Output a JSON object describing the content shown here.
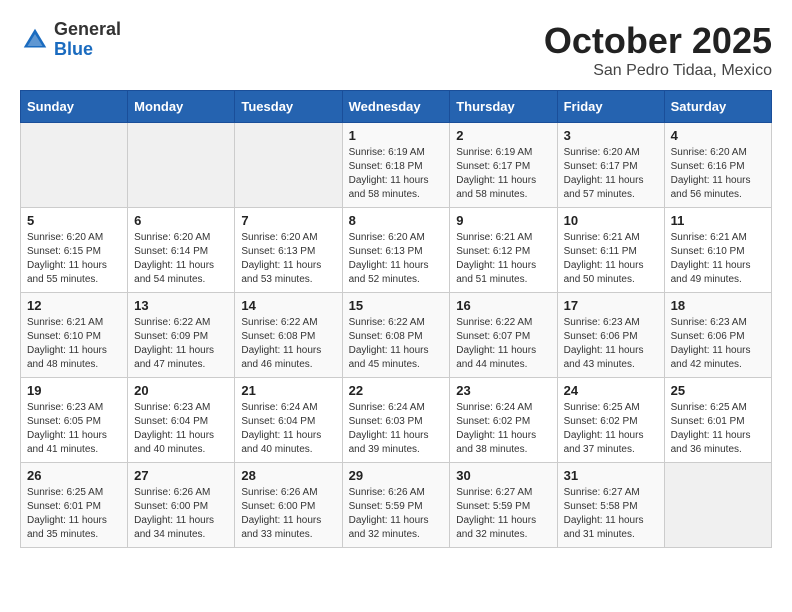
{
  "header": {
    "logo_general": "General",
    "logo_blue": "Blue",
    "month_title": "October 2025",
    "location": "San Pedro Tidaa, Mexico"
  },
  "days_of_week": [
    "Sunday",
    "Monday",
    "Tuesday",
    "Wednesday",
    "Thursday",
    "Friday",
    "Saturday"
  ],
  "weeks": [
    [
      {
        "day": "",
        "sunrise": "",
        "sunset": "",
        "daylight": ""
      },
      {
        "day": "",
        "sunrise": "",
        "sunset": "",
        "daylight": ""
      },
      {
        "day": "",
        "sunrise": "",
        "sunset": "",
        "daylight": ""
      },
      {
        "day": "1",
        "sunrise": "Sunrise: 6:19 AM",
        "sunset": "Sunset: 6:18 PM",
        "daylight": "Daylight: 11 hours and 58 minutes."
      },
      {
        "day": "2",
        "sunrise": "Sunrise: 6:19 AM",
        "sunset": "Sunset: 6:17 PM",
        "daylight": "Daylight: 11 hours and 58 minutes."
      },
      {
        "day": "3",
        "sunrise": "Sunrise: 6:20 AM",
        "sunset": "Sunset: 6:17 PM",
        "daylight": "Daylight: 11 hours and 57 minutes."
      },
      {
        "day": "4",
        "sunrise": "Sunrise: 6:20 AM",
        "sunset": "Sunset: 6:16 PM",
        "daylight": "Daylight: 11 hours and 56 minutes."
      }
    ],
    [
      {
        "day": "5",
        "sunrise": "Sunrise: 6:20 AM",
        "sunset": "Sunset: 6:15 PM",
        "daylight": "Daylight: 11 hours and 55 minutes."
      },
      {
        "day": "6",
        "sunrise": "Sunrise: 6:20 AM",
        "sunset": "Sunset: 6:14 PM",
        "daylight": "Daylight: 11 hours and 54 minutes."
      },
      {
        "day": "7",
        "sunrise": "Sunrise: 6:20 AM",
        "sunset": "Sunset: 6:13 PM",
        "daylight": "Daylight: 11 hours and 53 minutes."
      },
      {
        "day": "8",
        "sunrise": "Sunrise: 6:20 AM",
        "sunset": "Sunset: 6:13 PM",
        "daylight": "Daylight: 11 hours and 52 minutes."
      },
      {
        "day": "9",
        "sunrise": "Sunrise: 6:21 AM",
        "sunset": "Sunset: 6:12 PM",
        "daylight": "Daylight: 11 hours and 51 minutes."
      },
      {
        "day": "10",
        "sunrise": "Sunrise: 6:21 AM",
        "sunset": "Sunset: 6:11 PM",
        "daylight": "Daylight: 11 hours and 50 minutes."
      },
      {
        "day": "11",
        "sunrise": "Sunrise: 6:21 AM",
        "sunset": "Sunset: 6:10 PM",
        "daylight": "Daylight: 11 hours and 49 minutes."
      }
    ],
    [
      {
        "day": "12",
        "sunrise": "Sunrise: 6:21 AM",
        "sunset": "Sunset: 6:10 PM",
        "daylight": "Daylight: 11 hours and 48 minutes."
      },
      {
        "day": "13",
        "sunrise": "Sunrise: 6:22 AM",
        "sunset": "Sunset: 6:09 PM",
        "daylight": "Daylight: 11 hours and 47 minutes."
      },
      {
        "day": "14",
        "sunrise": "Sunrise: 6:22 AM",
        "sunset": "Sunset: 6:08 PM",
        "daylight": "Daylight: 11 hours and 46 minutes."
      },
      {
        "day": "15",
        "sunrise": "Sunrise: 6:22 AM",
        "sunset": "Sunset: 6:08 PM",
        "daylight": "Daylight: 11 hours and 45 minutes."
      },
      {
        "day": "16",
        "sunrise": "Sunrise: 6:22 AM",
        "sunset": "Sunset: 6:07 PM",
        "daylight": "Daylight: 11 hours and 44 minutes."
      },
      {
        "day": "17",
        "sunrise": "Sunrise: 6:23 AM",
        "sunset": "Sunset: 6:06 PM",
        "daylight": "Daylight: 11 hours and 43 minutes."
      },
      {
        "day": "18",
        "sunrise": "Sunrise: 6:23 AM",
        "sunset": "Sunset: 6:06 PM",
        "daylight": "Daylight: 11 hours and 42 minutes."
      }
    ],
    [
      {
        "day": "19",
        "sunrise": "Sunrise: 6:23 AM",
        "sunset": "Sunset: 6:05 PM",
        "daylight": "Daylight: 11 hours and 41 minutes."
      },
      {
        "day": "20",
        "sunrise": "Sunrise: 6:23 AM",
        "sunset": "Sunset: 6:04 PM",
        "daylight": "Daylight: 11 hours and 40 minutes."
      },
      {
        "day": "21",
        "sunrise": "Sunrise: 6:24 AM",
        "sunset": "Sunset: 6:04 PM",
        "daylight": "Daylight: 11 hours and 40 minutes."
      },
      {
        "day": "22",
        "sunrise": "Sunrise: 6:24 AM",
        "sunset": "Sunset: 6:03 PM",
        "daylight": "Daylight: 11 hours and 39 minutes."
      },
      {
        "day": "23",
        "sunrise": "Sunrise: 6:24 AM",
        "sunset": "Sunset: 6:02 PM",
        "daylight": "Daylight: 11 hours and 38 minutes."
      },
      {
        "day": "24",
        "sunrise": "Sunrise: 6:25 AM",
        "sunset": "Sunset: 6:02 PM",
        "daylight": "Daylight: 11 hours and 37 minutes."
      },
      {
        "day": "25",
        "sunrise": "Sunrise: 6:25 AM",
        "sunset": "Sunset: 6:01 PM",
        "daylight": "Daylight: 11 hours and 36 minutes."
      }
    ],
    [
      {
        "day": "26",
        "sunrise": "Sunrise: 6:25 AM",
        "sunset": "Sunset: 6:01 PM",
        "daylight": "Daylight: 11 hours and 35 minutes."
      },
      {
        "day": "27",
        "sunrise": "Sunrise: 6:26 AM",
        "sunset": "Sunset: 6:00 PM",
        "daylight": "Daylight: 11 hours and 34 minutes."
      },
      {
        "day": "28",
        "sunrise": "Sunrise: 6:26 AM",
        "sunset": "Sunset: 6:00 PM",
        "daylight": "Daylight: 11 hours and 33 minutes."
      },
      {
        "day": "29",
        "sunrise": "Sunrise: 6:26 AM",
        "sunset": "Sunset: 5:59 PM",
        "daylight": "Daylight: 11 hours and 32 minutes."
      },
      {
        "day": "30",
        "sunrise": "Sunrise: 6:27 AM",
        "sunset": "Sunset: 5:59 PM",
        "daylight": "Daylight: 11 hours and 32 minutes."
      },
      {
        "day": "31",
        "sunrise": "Sunrise: 6:27 AM",
        "sunset": "Sunset: 5:58 PM",
        "daylight": "Daylight: 11 hours and 31 minutes."
      },
      {
        "day": "",
        "sunrise": "",
        "sunset": "",
        "daylight": ""
      }
    ]
  ]
}
